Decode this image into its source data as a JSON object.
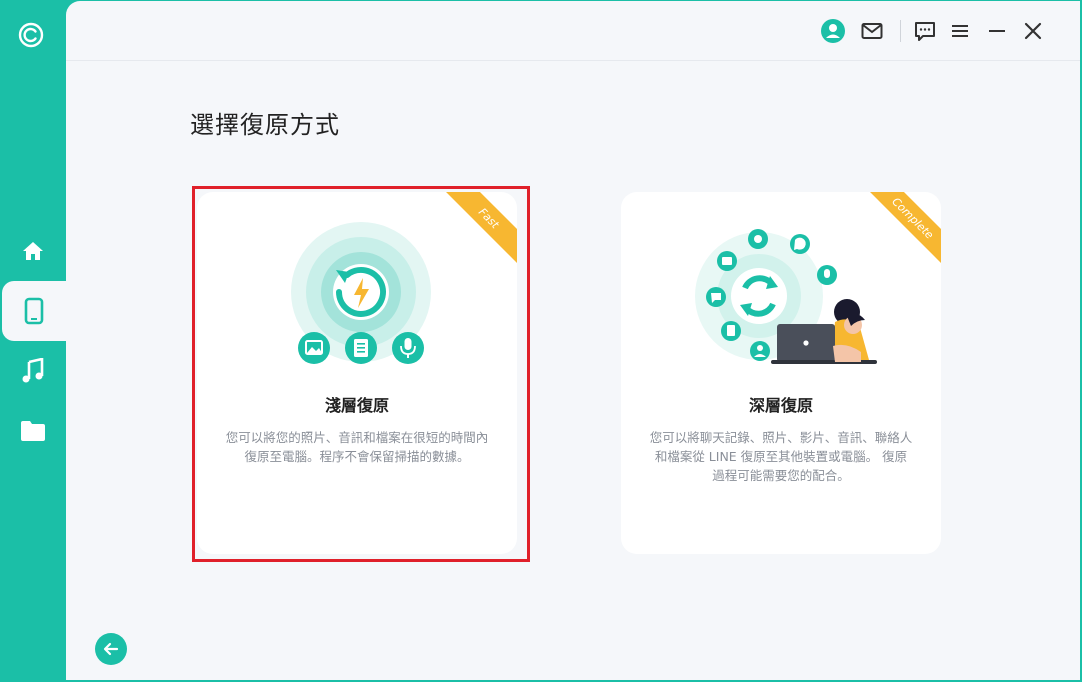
{
  "page": {
    "title": "選擇復原方式"
  },
  "options": [
    {
      "badge": "Fast",
      "title": "淺層復原",
      "description": "您可以將您的照片、音訊和檔案在很短的時間內復原至電腦。程序不會保留掃描的數據。"
    },
    {
      "badge": "Complete",
      "title": "深層復原",
      "description": "您可以將聊天記錄、照片、影片、音訊、聯絡人和檔案從 LINE 復原至其他裝置或電腦。 復原過程可能需要您的配合。"
    }
  ],
  "colors": {
    "accent": "#1bbfa7",
    "badge": "#f7b731",
    "highlight": "#e0202a"
  },
  "icons": {
    "sidebar": [
      "home-icon",
      "phone-icon",
      "music-icon",
      "folder-icon"
    ],
    "titlebar": [
      "user-avatar-icon",
      "mail-icon",
      "feedback-icon",
      "menu-icon",
      "minimize-icon",
      "close-icon"
    ]
  }
}
